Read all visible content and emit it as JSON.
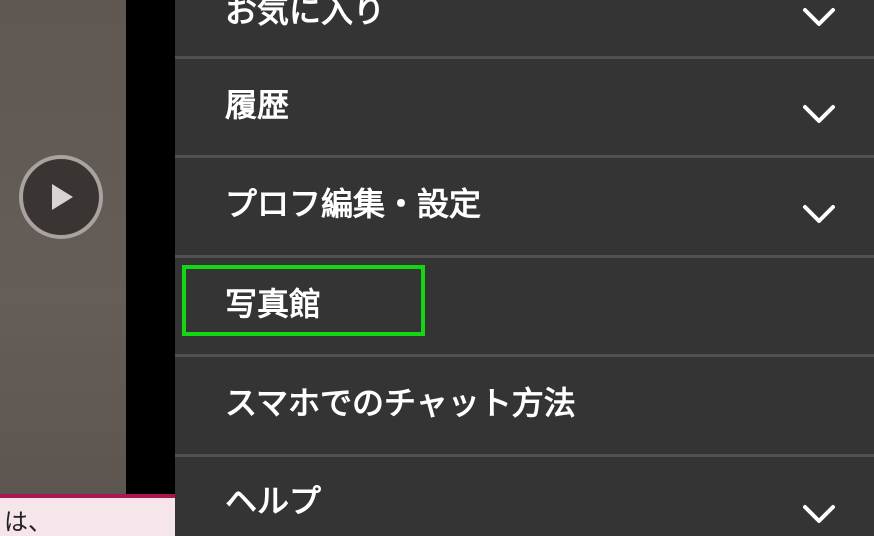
{
  "video": {
    "play_icon": "play-icon"
  },
  "page_snippet": {
    "text": "は、"
  },
  "menu": {
    "items": [
      {
        "label": "お気に入り",
        "expandable": true,
        "icon": "chevron-down-icon"
      },
      {
        "label": "履歴",
        "expandable": true,
        "icon": "chevron-down-icon"
      },
      {
        "label": "プロフ編集・設定",
        "expandable": true,
        "icon": "chevron-down-icon"
      },
      {
        "label": "写真館",
        "expandable": false,
        "highlighted": true
      },
      {
        "label": "スマホでのチャット方法",
        "expandable": false
      },
      {
        "label": "ヘルプ",
        "expandable": true,
        "icon": "chevron-down-icon"
      }
    ]
  },
  "colors": {
    "menu_background": "#343434",
    "divider": "#505050",
    "highlight": "#15d615",
    "accent_strip": "#a8174f"
  }
}
